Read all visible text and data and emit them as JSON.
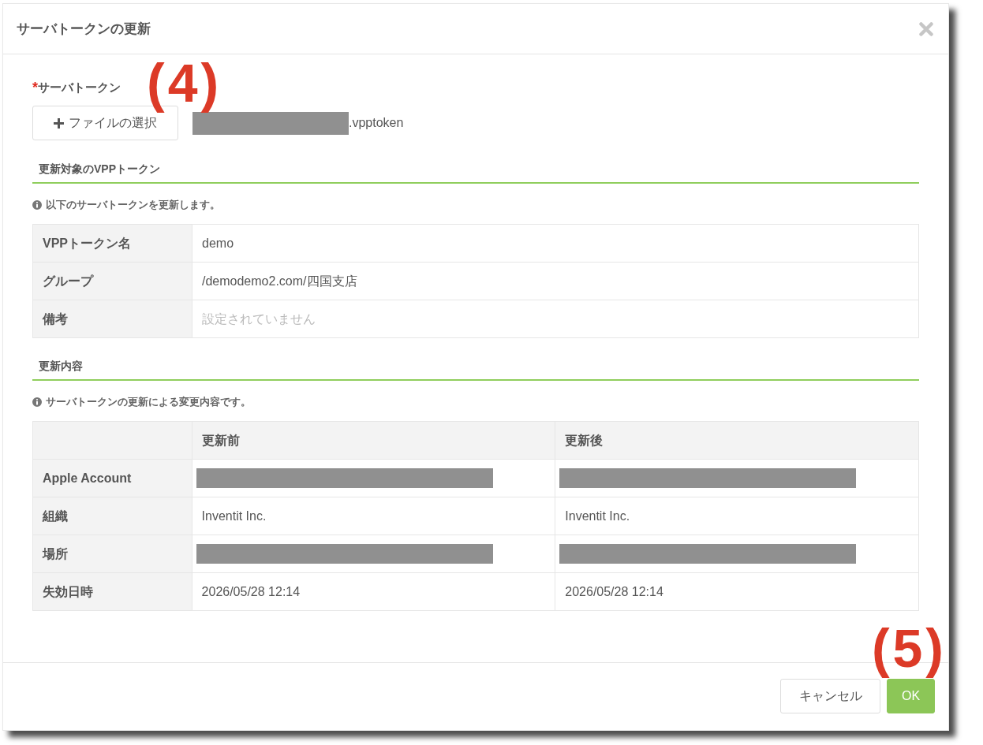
{
  "dialog": {
    "title": "サーバトークンの更新"
  },
  "token_field": {
    "required_mark": "*",
    "label": "サーバトークン",
    "annotation": "(4)",
    "button": "ファイルの選択",
    "file_name_redacted": true,
    "file_suffix": ".vpptoken"
  },
  "sections": [
    {
      "heading": "更新対象のVPPトークン",
      "info": "以下のサーバトークンを更新します。",
      "table": {
        "rows": [
          {
            "label": "VPPトークン名",
            "cells": [
              {
                "text": "demo",
                "redacted": false,
                "muted": false
              }
            ]
          },
          {
            "label": "グループ",
            "cells": [
              {
                "text": "/demodemo2.com/四国支店",
                "redacted": false,
                "muted": false
              }
            ]
          },
          {
            "label": "備考",
            "cells": [
              {
                "text": "設定されていません",
                "redacted": false,
                "muted": true
              }
            ]
          }
        ]
      }
    },
    {
      "heading": "更新内容",
      "info": "サーバトークンの更新による変更内容です。",
      "table": {
        "columns": [
          "更新前",
          "更新後"
        ],
        "rows": [
          {
            "label": "Apple Account",
            "cells": [
              {
                "redacted": true
              },
              {
                "redacted": true
              }
            ]
          },
          {
            "label": "組織",
            "cells": [
              {
                "text": "Inventit Inc.",
                "redacted": false,
                "muted": false
              },
              {
                "text": "Inventit Inc.",
                "redacted": false,
                "muted": false
              }
            ]
          },
          {
            "label": "場所",
            "cells": [
              {
                "redacted": true
              },
              {
                "redacted": true
              }
            ]
          },
          {
            "label": "失効日時",
            "cells": [
              {
                "text": "2026/05/28 12:14",
                "redacted": false,
                "muted": false
              },
              {
                "text": "2026/05/28 12:14",
                "redacted": false,
                "muted": false
              }
            ]
          }
        ]
      }
    }
  ],
  "footer": {
    "annotation": "(5)",
    "buttons": [
      {
        "label": "キャンセル",
        "kind": "default"
      },
      {
        "label": "OK",
        "kind": "primary"
      }
    ]
  }
}
